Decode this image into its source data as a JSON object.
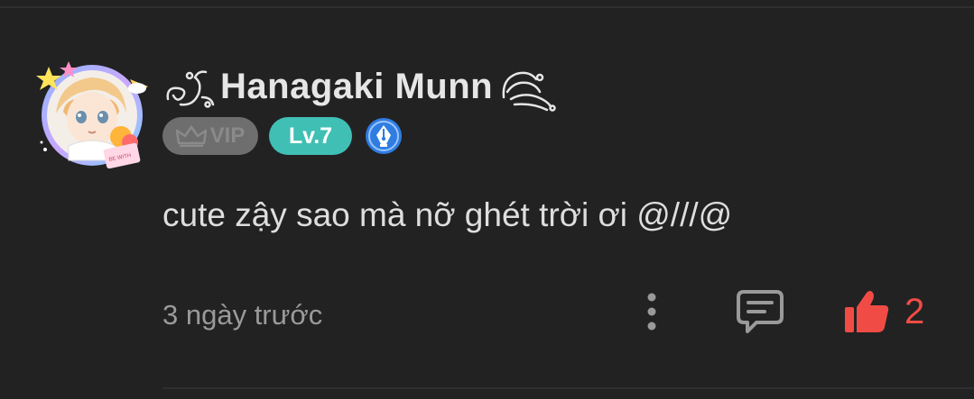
{
  "comment": {
    "username": "Hanagaki Munn",
    "vip_label": "VIP",
    "level_label": "Lv.7",
    "text": "cute zậy sao mà nỡ ghét trời ơi @///@",
    "timestamp": "3 ngày trước",
    "likes": "2"
  },
  "colors": {
    "background": "#222223",
    "level_badge": "#40bfb4",
    "vip_badge": "#6e6e6e",
    "like": "#f04c45",
    "pen_badge": "#2f7de1"
  },
  "icons": {
    "avatar": "anime-avatar",
    "name_decoration_left": "swirl-decoration-icon",
    "name_decoration_right": "wing-decoration-icon",
    "vip": "crown-icon",
    "writer_badge": "pen-nib-icon",
    "more": "more-vertical-icon",
    "reply": "chat-bubble-icon",
    "like": "thumbs-up-icon"
  }
}
